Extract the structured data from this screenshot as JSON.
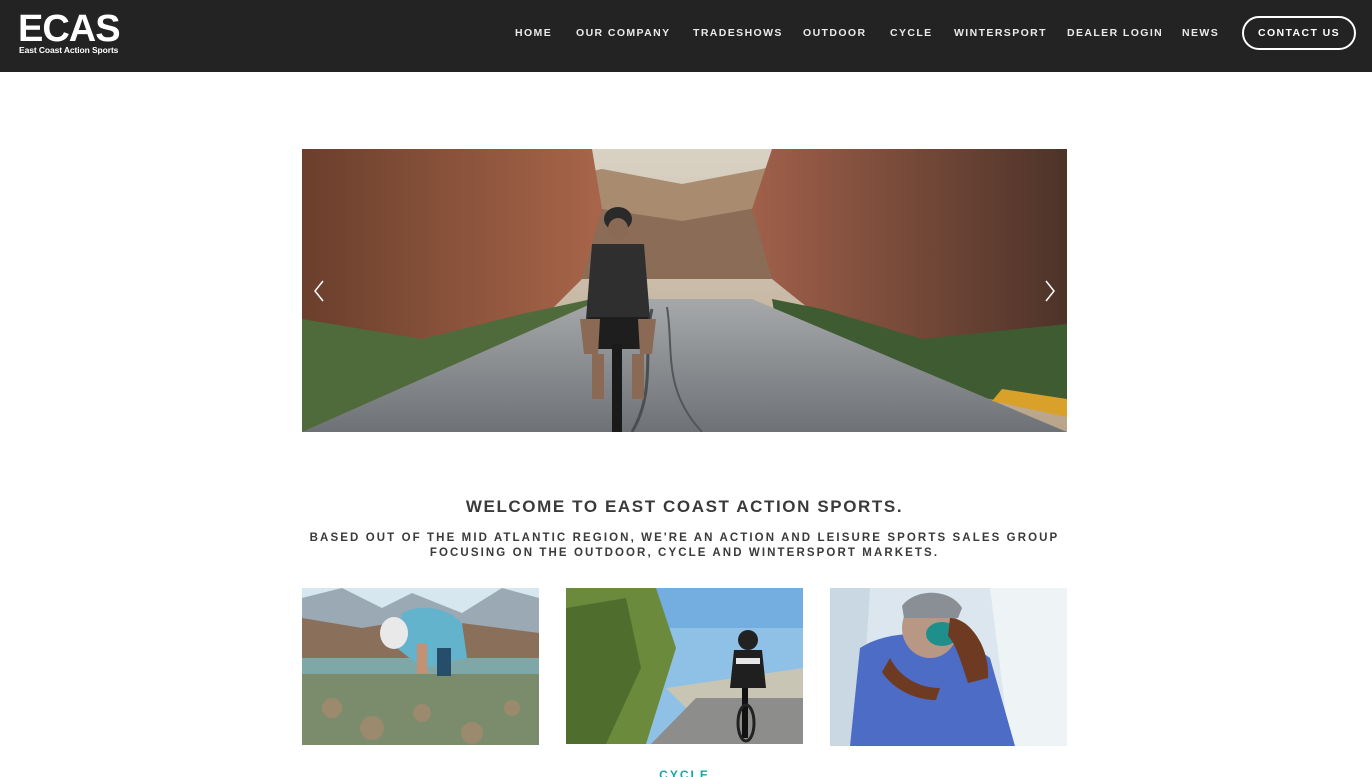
{
  "brand": {
    "logo_main": "ECAS",
    "logo_sub": "East Coast Action Sports"
  },
  "nav": {
    "items": [
      "HOME",
      "OUR COMPANY",
      "TRADESHOWS",
      "OUTDOOR",
      "CYCLE",
      "WINTERSPORT",
      "DEALER LOGIN",
      "NEWS"
    ],
    "contact_label": "CONTACT US"
  },
  "hero": {
    "image_icon": "cyclist-canyon-road-photo",
    "prev_icon": "chevron-left-icon",
    "next_icon": "chevron-right-icon"
  },
  "intro": {
    "heading": "WELCOME TO EAST COAST ACTION SPORTS.",
    "tagline": "BASED OUT OF THE MID ATLANTIC REGION, WE'RE AN ACTION AND LEISURE SPORTS SALES GROUP FOCUSING ON THE OUTDOOR, CYCLE AND WINTERSPORT MARKETS."
  },
  "categories": {
    "tiles": [
      {
        "icon": "outdoor-river-photo"
      },
      {
        "icon": "cycle-road-photo"
      },
      {
        "icon": "wintersport-goggles-photo"
      }
    ],
    "first_label": "CYCLE"
  },
  "colors": {
    "header_bg": "#232323",
    "accent": "#1aa7a0"
  }
}
